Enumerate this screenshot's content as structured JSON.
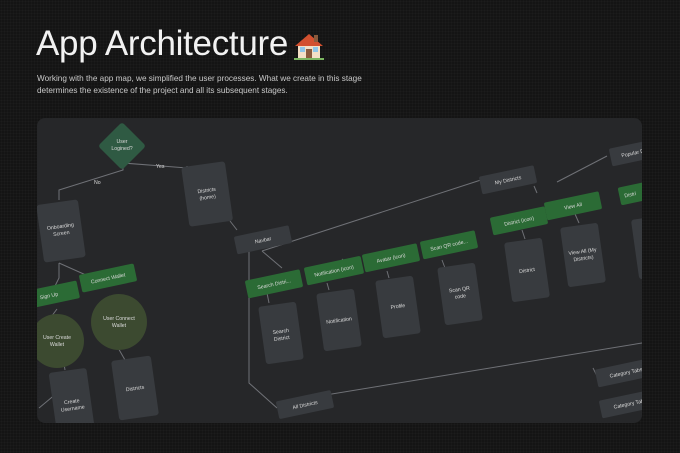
{
  "header": {
    "title": "App Architecture",
    "title_icon": "house-icon",
    "description": "Working with the app map, we simplified the user processes. What we create in this stage determines the existence of the project and all its subsequent stages."
  },
  "diagram": {
    "decision": {
      "line1": "User",
      "line2": "Logined?"
    },
    "branch_no": "No",
    "branch_yes": "Yes",
    "onboarding": {
      "line1": "Onboarding",
      "line2": "Screen"
    },
    "sign_up": "Sign Up",
    "connect_wallet": "Connect Wallet",
    "user_create_wallet": {
      "line1": "User Create",
      "line2": "Wallet"
    },
    "user_connect_wallet": {
      "line1": "User Connect",
      "line2": "Wallet"
    },
    "create_username": {
      "line1": "Create",
      "line2": "Username"
    },
    "districts_screen": "Districts",
    "districts_home": {
      "line1": "Districts",
      "line2": "(home)"
    },
    "navbar": "Navbar",
    "search_district_tab": "Search Distri...",
    "notification_tab": "Notification (icon)",
    "avatar_tab": "Avatar (icon)",
    "scan_qr_tab": "Scan QR code...",
    "search_district_screen": {
      "line1": "Search",
      "line2": "District"
    },
    "notification_screen": "Notification",
    "profile_screen": "Profile",
    "scan_qr_screen": {
      "line1": "Scan QR",
      "line2": "code"
    },
    "my_districts": "My Districts",
    "district_icon_tab": "District (icon)",
    "view_all_tab": "View All",
    "district_screen": "District",
    "view_all_screen": {
      "line1": "View All (My",
      "line2": "Districts)"
    },
    "popular_districts": "Popular Dis",
    "all_districts": "All Districts",
    "category_tabs_1": "Category Tabs",
    "category_tabs_2": "Category Tabs",
    "partial_green": "Distri"
  },
  "colors": {
    "background": "#141414",
    "board": "#262729",
    "node_dark": "#383b3f",
    "node_green": "#2b6b35",
    "decision_green": "#2f5a43",
    "circle_olive": "#3c4a30",
    "connector": "#6f7176"
  }
}
